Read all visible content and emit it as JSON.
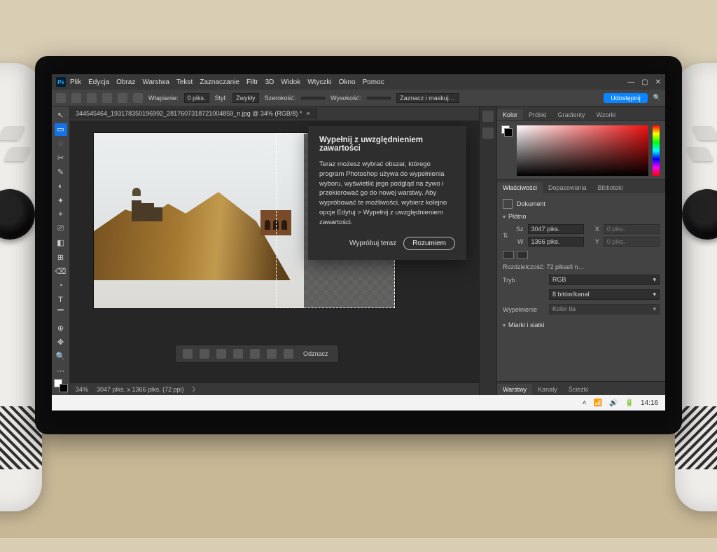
{
  "app": {
    "logo": "Ps"
  },
  "menu": [
    "Plik",
    "Edycja",
    "Obraz",
    "Warstwa",
    "Tekst",
    "Zaznaczanie",
    "Filtr",
    "3D",
    "Widok",
    "Wtyczki",
    "Okno",
    "Pomoc"
  ],
  "option_bar": {
    "feather_label": "Wtapianie:",
    "feather_value": "0 piks.",
    "style_label": "Styl:",
    "style_value": "Zwykły",
    "width_label": "Szerokość:",
    "height_label": "Wysokość:",
    "select_mask": "Zaznacz i maskuj…",
    "share": "Udostępnij"
  },
  "document": {
    "tab": "344545464_193178350196992_2817607318721004859_n.jpg @ 34% (RGB/8) *",
    "zoom": "34%",
    "info": "3047 piks. x 1366 piks. (72 ppi)"
  },
  "context_bar": {
    "deselect": "Odznacz"
  },
  "tooltip": {
    "title": "Wypełnij z uwzględnieniem zawartości",
    "body": "Teraz możesz wybrać obszar, którego program Photoshop używa do wypełnienia wyboru, wyświetlić jego podgląd na żywo i przekierować go do nowej warstwy. Aby wypróbować te możliwości, wybierz kolejno opcje Edytuj > Wypełnij z uwzględnieniem zawartości.",
    "try": "Wypróbuj teraz",
    "ok": "Rozumiem"
  },
  "panels": {
    "color_tabs": [
      "Kolor",
      "Próbki",
      "Gradienty",
      "Wzorki"
    ],
    "prop_tabs": [
      "Właściwości",
      "Dopasowania",
      "Biblioteki"
    ],
    "doc_label": "Dokument",
    "canvas_header": "Płótno",
    "sz_label": "Sz",
    "w_label": "W",
    "x_label": "X",
    "y_label": "Y",
    "sz_value": "3047 piks.",
    "w_value": "1366 piks.",
    "x_value": "0 piks.",
    "y_value": "0 piks.",
    "resolution": "Rozdzielczość: 72 pikseli n…",
    "mode_label": "Tryb",
    "mode_value": "RGB",
    "depth_value": "8 bitów/kanał",
    "fill_label": "Wypełnienie",
    "fill_value": "Kolor tła",
    "rulers_header": "Miarki i siatki",
    "bottom_tabs": [
      "Warstwy",
      "Kanały",
      "Ścieżki"
    ]
  },
  "tools": [
    "↖",
    "▭",
    "◌",
    "✂",
    "✎",
    "◐",
    "✦",
    "⌖",
    "⎚",
    "◧",
    "⊞",
    "⌫",
    "◔",
    "T",
    "▔",
    "⊕",
    "✥",
    "🔍",
    "⋯"
  ],
  "taskbar": {
    "time": "14:16"
  }
}
